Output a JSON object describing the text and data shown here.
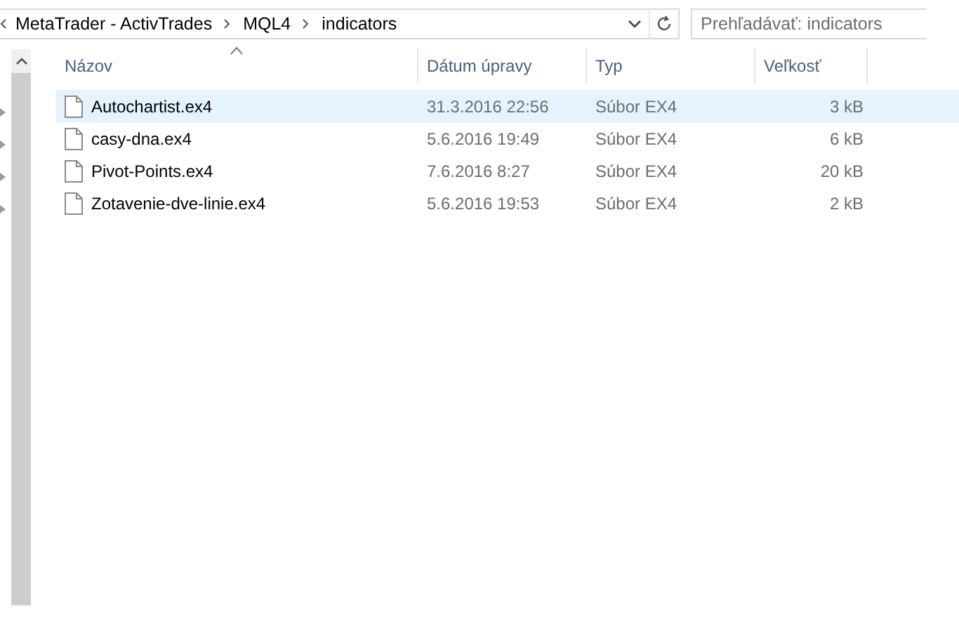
{
  "address_bar": {
    "path": [
      "MetaTrader - ActivTrades",
      "MQL4",
      "indicators"
    ]
  },
  "search": {
    "placeholder": "Prehľadávať: indicators"
  },
  "table": {
    "columns": [
      {
        "label": "Názov",
        "sorted": true
      },
      {
        "label": "Dátum úpravy",
        "sorted": false
      },
      {
        "label": "Typ",
        "sorted": false
      },
      {
        "label": "Veľkosť",
        "sorted": false
      }
    ],
    "rows": [
      {
        "name": "Autochartist.ex4",
        "date": "31.3.2016 22:56",
        "type": "Súbor EX4",
        "size": "3 kB",
        "selected": true
      },
      {
        "name": "casy-dna.ex4",
        "date": "5.6.2016 19:49",
        "type": "Súbor EX4",
        "size": "6 kB",
        "selected": false
      },
      {
        "name": "Pivot-Points.ex4",
        "date": "7.6.2016 8:27",
        "type": "Súbor EX4",
        "size": "20 kB",
        "selected": false
      },
      {
        "name": "Zotavenie-dve-linie.ex4",
        "date": "5.6.2016 19:53",
        "type": "Súbor EX4",
        "size": "2 kB",
        "selected": false
      }
    ]
  }
}
